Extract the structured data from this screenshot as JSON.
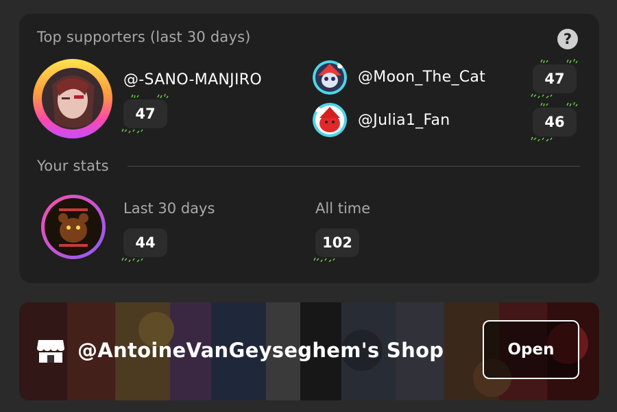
{
  "top_supporters": {
    "title": "Top supporters (last 30 days)",
    "help_icon": "help-icon",
    "first": {
      "username": "@-SANO-MANJIRO",
      "count": "47",
      "avatar": "red-haired-character-avatar"
    },
    "others": [
      {
        "username": "@Moon_The_Cat",
        "count": "47",
        "avatar": "santa-hat-character-avatar"
      },
      {
        "username": "@Julia1_Fan",
        "count": "46",
        "avatar": "red-blob-santa-avatar"
      }
    ]
  },
  "your_stats": {
    "title": "Your stats",
    "avatar": "bear-game-studio-avatar",
    "last_30_label": "Last 30 days",
    "last_30_value": "44",
    "all_time_label": "All time",
    "all_time_value": "102"
  },
  "shop": {
    "icon": "storefront-icon",
    "name": "@AntoineVanGeyseghem's Shop",
    "open_label": "Open"
  },
  "colors": {
    "background": "#2a2a2a",
    "card": "#1f1f1f",
    "muted_text": "#a9a9a9",
    "count_pill": "#2c2c2c",
    "sprout_green": "#6cd64a"
  }
}
